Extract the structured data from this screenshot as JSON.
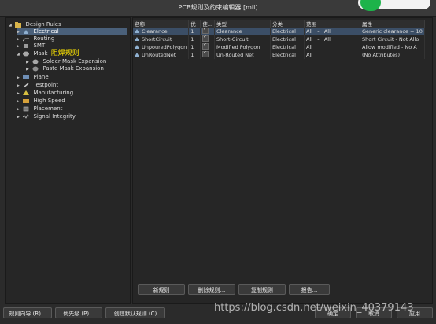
{
  "window": {
    "title": "PCB规则及约束编辑器 [mil]"
  },
  "tree": {
    "root": "Design Rules",
    "items": [
      {
        "label": "Electrical",
        "selected": true
      },
      {
        "label": "Routing"
      },
      {
        "label": "SMT"
      },
      {
        "label": "Mask",
        "annotation": "阻焊规则"
      },
      {
        "label": "Solder Mask Expansion"
      },
      {
        "label": "Paste Mask Expansion"
      },
      {
        "label": "Plane"
      },
      {
        "label": "Testpoint"
      },
      {
        "label": "Manufacturing"
      },
      {
        "label": "High Speed"
      },
      {
        "label": "Placement"
      },
      {
        "label": "Signal Integrity"
      }
    ]
  },
  "table": {
    "headers": [
      "名称",
      "优",
      "使...",
      "类型",
      "分类",
      "范围",
      "属性"
    ],
    "rows": [
      {
        "name": "Clearance",
        "priority": "1",
        "type": "Clearance",
        "category": "Electrical",
        "scope1": "All",
        "dash": "-",
        "scope2": "All",
        "attributes": "Generic clearance = 10"
      },
      {
        "name": "ShortCircuit",
        "priority": "1",
        "type": "Short-Circuit",
        "category": "Electrical",
        "scope1": "All",
        "dash": "-",
        "scope2": "All",
        "attributes": "Short Circuit - Not Allo"
      },
      {
        "name": "UnpouredPolygon",
        "priority": "1",
        "type": "Modified Polygon",
        "category": "Electrical",
        "scope1": "All",
        "dash": "",
        "scope2": "",
        "attributes": "Allow modified - No A"
      },
      {
        "name": "UnRoutedNet",
        "priority": "1",
        "type": "Un-Routed Net",
        "category": "Electrical",
        "scope1": "All",
        "dash": "",
        "scope2": "",
        "attributes": "(No Attributes)"
      }
    ]
  },
  "actions": {
    "new_rule": "新规则",
    "delete_rule": "删除规则...",
    "copy_rule": "复制规则",
    "report": "报告..."
  },
  "footer": {
    "rule_wizard": "规则向导 (R)...",
    "priorities": "优先级 (P)...",
    "create_default": "创建默认规则 (C)",
    "ok": "确定",
    "cancel": "取消",
    "apply": "应用"
  },
  "watermark": "https://blog.csdn.net/weixin_40379143",
  "colors": {
    "accent_selection": "#4a607a",
    "toggle_green": "#1db34a",
    "annotation": "#ffe600"
  }
}
